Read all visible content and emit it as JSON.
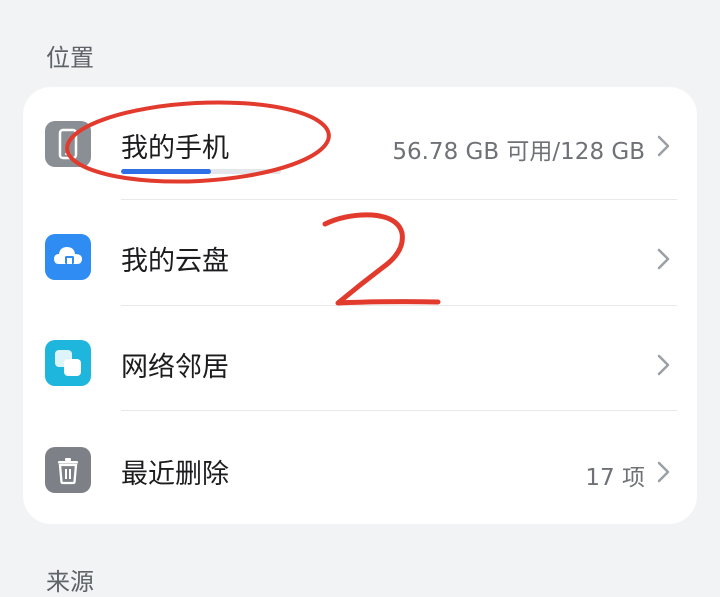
{
  "sections": {
    "location": "位置",
    "source": "来源"
  },
  "storage_items": [
    {
      "label": "我的手机",
      "value": "56.78 GB 可用/128 GB",
      "icon": "phone-icon",
      "storage_used_fraction": 0.56
    },
    {
      "label": "我的云盘",
      "value": "",
      "icon": "cloud-icon"
    },
    {
      "label": "网络邻居",
      "value": "",
      "icon": "network-icon"
    },
    {
      "label": "最近删除",
      "value": "17 项",
      "icon": "trash-icon"
    }
  ],
  "colors": {
    "background": "#f1f3f5",
    "card": "#ffffff",
    "cloud_icon": "#2e8cf3",
    "network_icon": "#1eb6dd",
    "phone_icon": "#8a8f96",
    "trash_icon": "#7d8187",
    "progress_fill": "#2f6fe6",
    "annotation": "#e23b2e"
  }
}
